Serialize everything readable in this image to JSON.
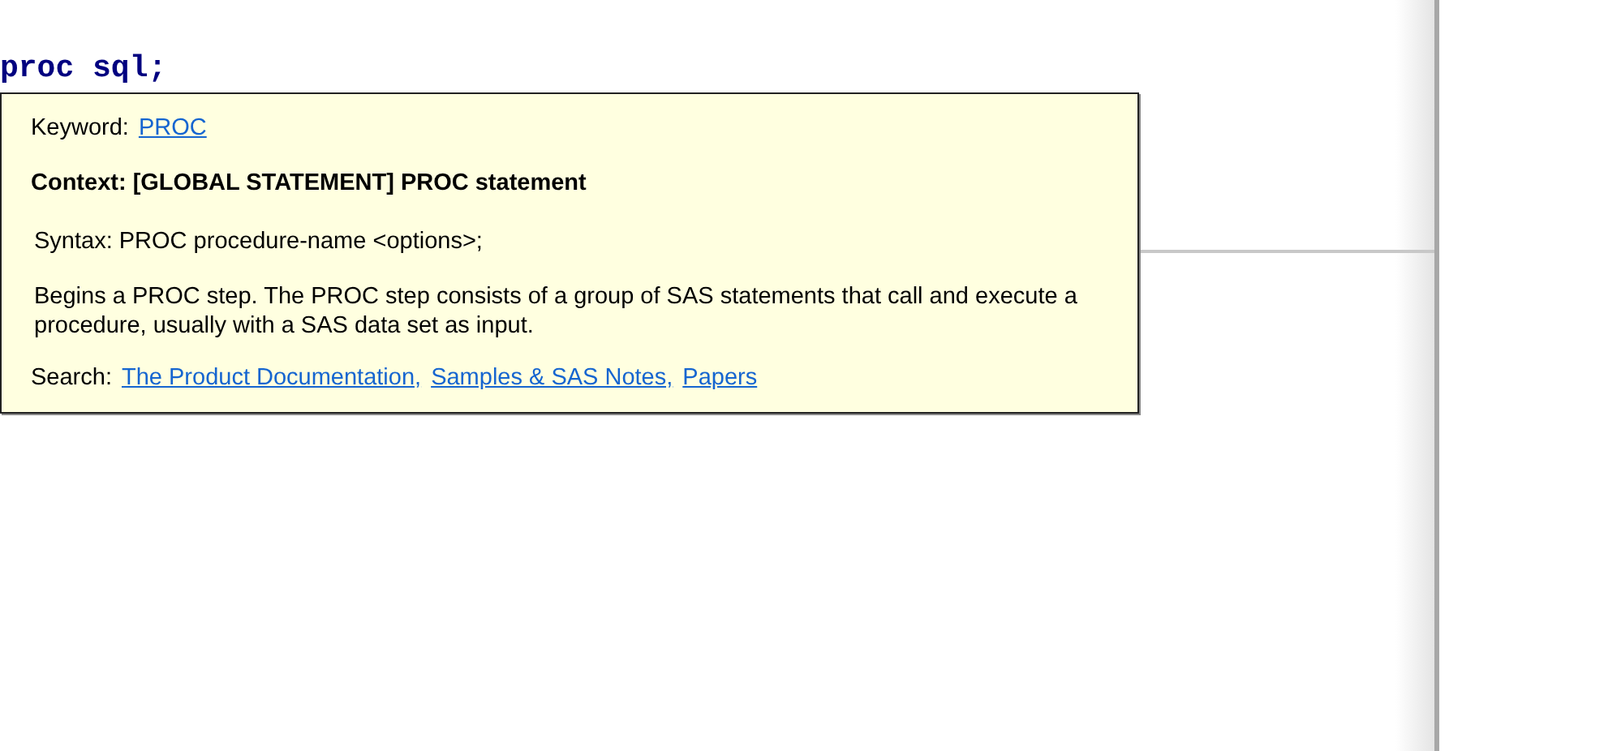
{
  "editor": {
    "code_lines": [
      "proc sql;"
    ]
  },
  "tooltip": {
    "keyword_label": "Keyword:",
    "keyword": "PROC",
    "context": "Context: [GLOBAL STATEMENT] PROC statement",
    "syntax": "Syntax: PROC procedure-name <options>;",
    "description": "Begins a PROC step. The PROC step consists of a group of SAS statements that call and execute a procedure, usually with a SAS data set as input.",
    "search_label": "Search:",
    "search_links": [
      "The Product Documentation,",
      "Samples & SAS Notes,",
      "Papers"
    ]
  }
}
